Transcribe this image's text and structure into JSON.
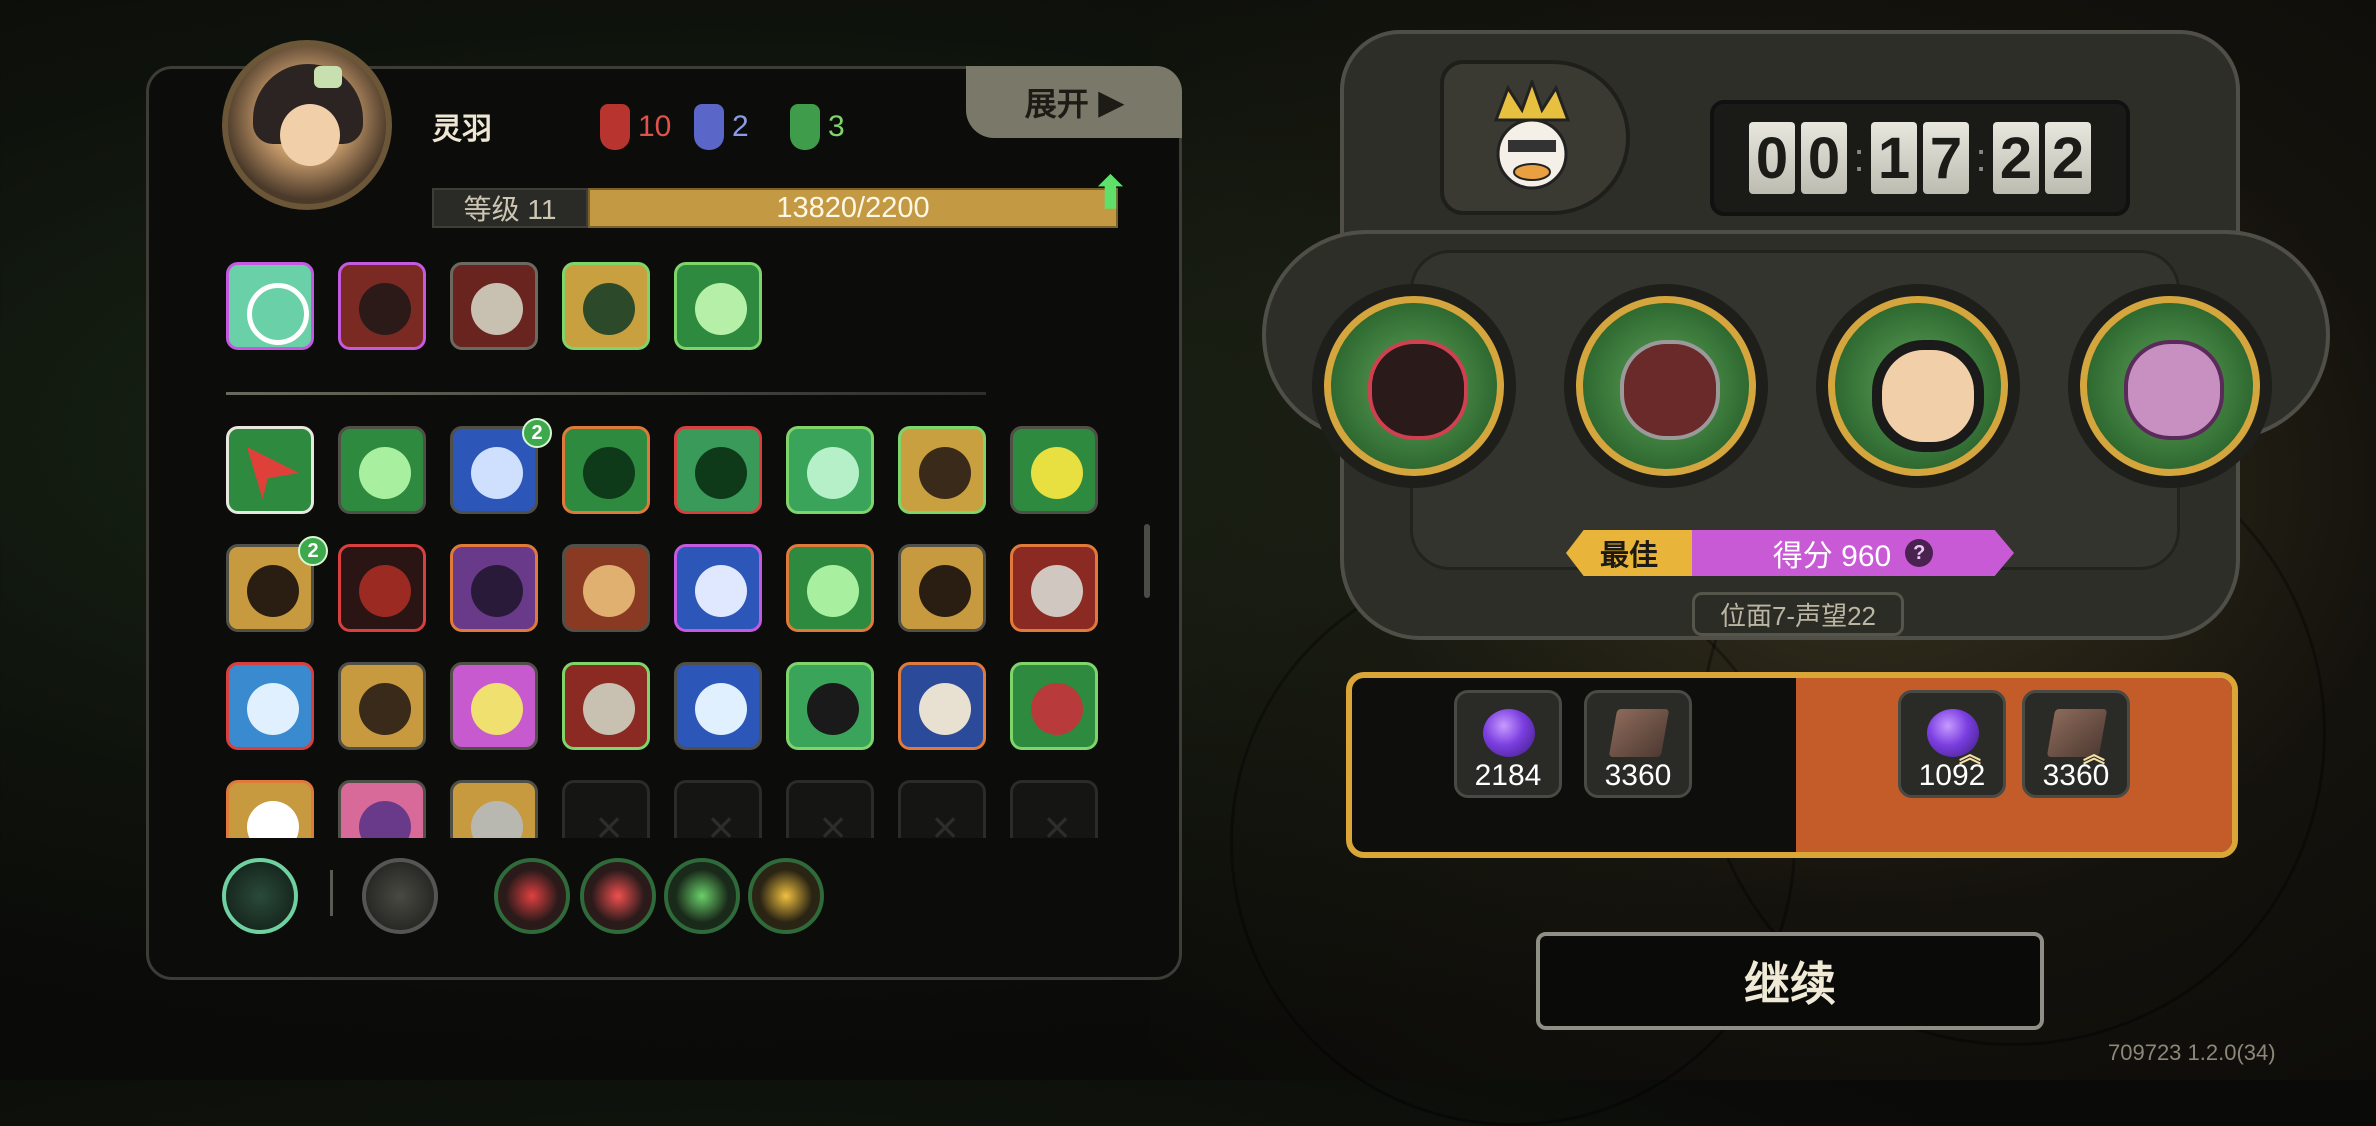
{
  "character": {
    "name": "灵羽"
  },
  "resources": [
    {
      "value": "10",
      "color": "#e0534a"
    },
    {
      "value": "2",
      "color": "#8d9be6"
    },
    {
      "value": "3",
      "color": "#7fd46a"
    }
  ],
  "expand_label": "展开",
  "level": {
    "label": "等级 11",
    "xp_text": "13820/2200"
  },
  "timer": {
    "digits": [
      "0",
      "0",
      "1",
      "7",
      "2",
      "2"
    ]
  },
  "best_label": "最佳",
  "score_label": "得分 960",
  "help_label": "?",
  "plane_label": "位面7-声望22",
  "rewards": [
    {
      "icon": "purple-orb",
      "value": "2184"
    },
    {
      "icon": "book",
      "value": "3360"
    },
    {
      "icon": "purple-orb-upgraded",
      "value": "1092"
    },
    {
      "icon": "book-upgraded",
      "value": "3360"
    }
  ],
  "skill_badges": [
    "2",
    "2"
  ],
  "continue_label": "继续",
  "version": "709723 1.2.0(34)",
  "colors": {
    "accent_gold": "#d9a637",
    "score_purple": "#c95ad6",
    "reward_orange": "#c35c29"
  }
}
